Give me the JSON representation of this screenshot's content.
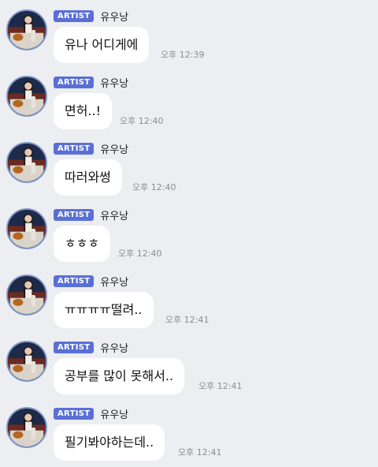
{
  "messages": [
    {
      "badge": "ARTIST",
      "sender": "유우낭",
      "text": "유나 어디게에",
      "time": "오후 12:39"
    },
    {
      "badge": "ARTIST",
      "sender": "유우낭",
      "text": "면허..!",
      "time": "오후 12:40"
    },
    {
      "badge": "ARTIST",
      "sender": "유우낭",
      "text": "따러와썽",
      "time": "오후 12:40"
    },
    {
      "badge": "ARTIST",
      "sender": "유우낭",
      "text": "ㅎㅎㅎ",
      "time": "오후 12:40"
    },
    {
      "badge": "ARTIST",
      "sender": "유우낭",
      "text": "ㅠㅠㅠㅠ떨려..",
      "time": "오후 12:41"
    },
    {
      "badge": "ARTIST",
      "sender": "유우낭",
      "text": "공부를 많이 못해서..",
      "time": "오후 12:41"
    },
    {
      "badge": "ARTIST",
      "sender": "유우낭",
      "text": "필기봐야하는데..",
      "time": "오후 12:41"
    }
  ],
  "colors": {
    "background": "#eceef1",
    "badge": "#5a6fd6",
    "bubble": "#ffffff",
    "avatar_ring": "#7f97c9"
  },
  "icons": {
    "avatar": "profile-photo"
  }
}
